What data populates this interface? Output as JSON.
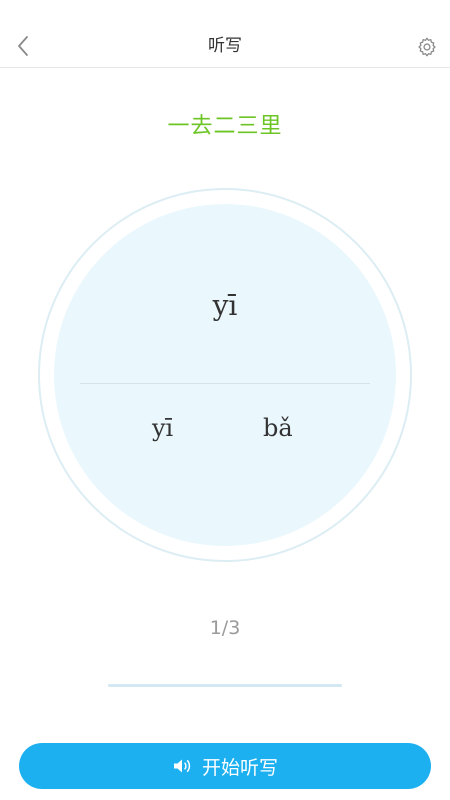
{
  "header": {
    "title": "听写",
    "back_icon": "chevron-left-icon",
    "settings_icon": "gear-icon"
  },
  "lesson": {
    "title": "一去二三里"
  },
  "card": {
    "pinyin": "yī",
    "options": [
      "yī",
      "bǎ"
    ]
  },
  "progress": {
    "current": 1,
    "total": 3,
    "label": "1/3"
  },
  "start_button": {
    "label": "开始听写",
    "icon": "speaker-icon"
  },
  "colors": {
    "accent": "#1db0f0",
    "lesson_title": "#6cc524",
    "circle_fill": "#eaf8fe",
    "circle_border": "#dcedf4"
  }
}
